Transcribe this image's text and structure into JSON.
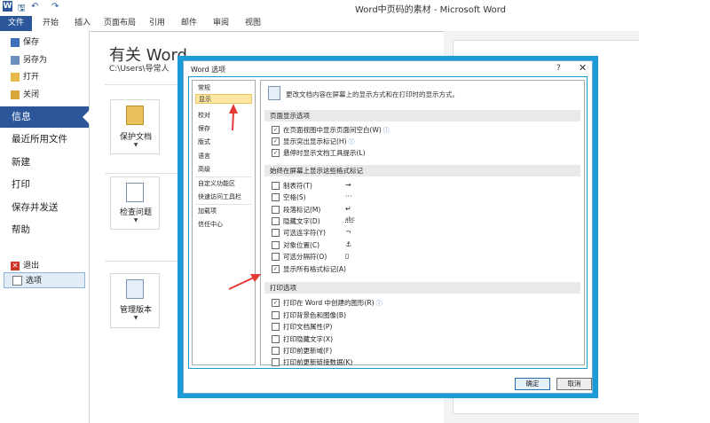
{
  "window": {
    "title": "Word中页码的素材 - Microsoft Word"
  },
  "quick_access": {
    "word_icon": "W",
    "save_icon": "save-icon",
    "undo_icon": "undo-icon",
    "redo_icon": "redo-icon"
  },
  "ribbon": {
    "tabs": [
      {
        "label": "文件"
      },
      {
        "label": "开始"
      },
      {
        "label": "插入"
      },
      {
        "label": "页面布局"
      },
      {
        "label": "引用"
      },
      {
        "label": "邮件"
      },
      {
        "label": "审阅"
      },
      {
        "label": "视图"
      }
    ]
  },
  "backstage": {
    "small_items": [
      {
        "label": "保存",
        "icon": "save-icon"
      },
      {
        "label": "另存为",
        "icon": "save-as-icon"
      },
      {
        "label": "打开",
        "icon": "open-folder-icon"
      },
      {
        "label": "关闭",
        "icon": "close-folder-icon"
      }
    ],
    "selected": "信息",
    "big_items": [
      {
        "label": "最近所用文件"
      },
      {
        "label": "新建"
      },
      {
        "label": "打印"
      },
      {
        "label": "保存并发送"
      },
      {
        "label": "帮助"
      }
    ],
    "options_label": "选项",
    "exit_label": "退出",
    "info_title": "有关 Word",
    "info_path": "C:\\Users\\导常人",
    "buttons": [
      {
        "label": "保护文档",
        "icon": "lock-icon"
      },
      {
        "label": "检查问题",
        "icon": "checklist-icon"
      },
      {
        "label": "管理版本",
        "icon": "versions-icon"
      }
    ]
  },
  "dialog": {
    "title": "Word 选项",
    "help": "?",
    "close": "✕",
    "categories": [
      {
        "label": "常规"
      },
      {
        "label": "显示",
        "selected": true
      },
      {
        "label": "校对"
      },
      {
        "label": "保存"
      },
      {
        "label": "版式"
      },
      {
        "label": "语言"
      },
      {
        "label": "高级"
      },
      {
        "label": "自定义功能区"
      },
      {
        "label": "快速访问工具栏"
      },
      {
        "label": "加载项"
      },
      {
        "label": "信任中心"
      }
    ],
    "intro": "更改文档内容在屏幕上的显示方式和在打印时的显示方式。",
    "sections": [
      {
        "title": "页面显示选项",
        "options": [
          {
            "label": "在页面视图中显示页面间空白(W)",
            "checked": true,
            "info": true
          },
          {
            "label": "显示突出显示标记(H)",
            "checked": true,
            "info": true
          },
          {
            "label": "悬停时显示文档工具提示(L)",
            "checked": true
          }
        ]
      },
      {
        "title": "始终在屏幕上显示这些格式标记",
        "options": [
          {
            "label": "制表符(T)",
            "checked": false,
            "symbol": "→"
          },
          {
            "label": "空格(S)",
            "checked": false,
            "symbol": "···"
          },
          {
            "label": "段落标记(M)",
            "checked": false,
            "symbol": "↵"
          },
          {
            "label": "隐藏文字(D)",
            "checked": false,
            "symbol": "abc"
          },
          {
            "label": "可选连字符(Y)",
            "checked": false,
            "symbol": "¬"
          },
          {
            "label": "对象位置(C)",
            "checked": false,
            "symbol": "⚓"
          },
          {
            "label": "可选分隔符(O)",
            "checked": false,
            "symbol": "▯"
          },
          {
            "label": "显示所有格式标记(A)",
            "checked": true
          }
        ]
      },
      {
        "title": "打印选项",
        "options": [
          {
            "label": "打印在 Word 中创建的图形(R)",
            "checked": true,
            "info": true
          },
          {
            "label": "打印背景色和图像(B)",
            "checked": false
          },
          {
            "label": "打印文档属性(P)",
            "checked": false
          },
          {
            "label": "打印隐藏文字(X)",
            "checked": false
          },
          {
            "label": "打印前更新域(F)",
            "checked": false
          },
          {
            "label": "打印前更新链接数据(K)",
            "checked": false
          }
        ]
      }
    ],
    "ok_label": "确定",
    "cancel_label": "取消"
  },
  "colors": {
    "accent": "#2b579a",
    "dialog_frame": "#1c9ad6",
    "arrow": "#e53935",
    "selected_category": "#fde7a2"
  }
}
